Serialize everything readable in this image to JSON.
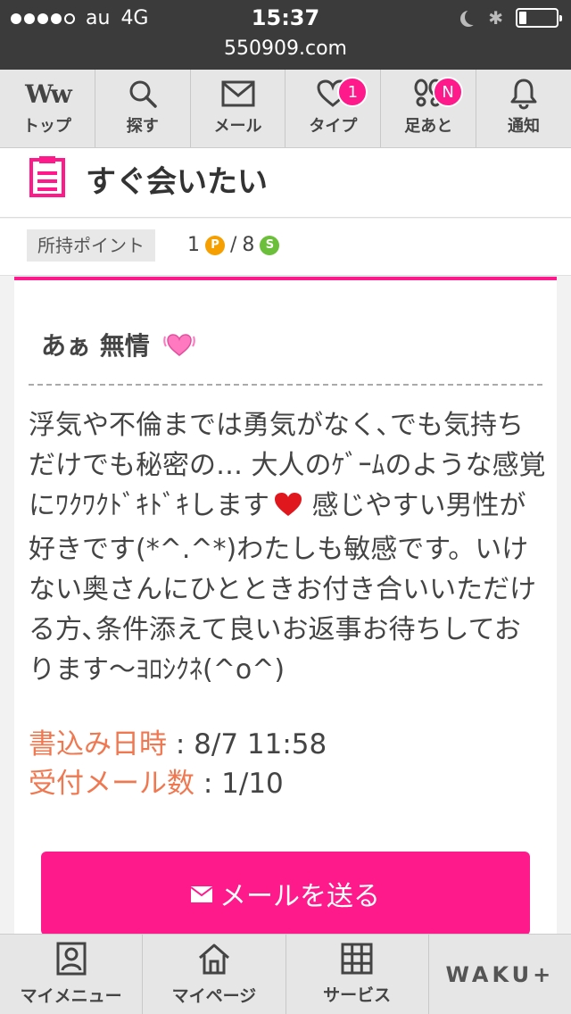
{
  "status": {
    "carrier": "au",
    "network": "4G",
    "time": "15:37",
    "url": "550909.com",
    "battery_level": 0.2
  },
  "nav": [
    {
      "label": "トップ",
      "icon": "ww-logo-icon"
    },
    {
      "label": "探す",
      "icon": "search-icon"
    },
    {
      "label": "メール",
      "icon": "mail-icon"
    },
    {
      "label": "タイプ",
      "icon": "heart-icon",
      "badge": "1"
    },
    {
      "label": "足あと",
      "icon": "footprint-icon",
      "badge": "N"
    },
    {
      "label": "通知",
      "icon": "bell-icon"
    }
  ],
  "nav_logo": "Ww",
  "page": {
    "title": "すぐ会いたい"
  },
  "points": {
    "label": "所持ポイント",
    "p_value": "1",
    "p_icon": "P",
    "separator": "/",
    "s_value": "8",
    "s_icon": "S"
  },
  "post": {
    "name": "あぁ 無情",
    "message_1": "浮気や不倫までは勇気がなく､でも気持ちだけでも秘密の… 大人のｹﾞｰﾑのような感覚にﾜｸﾜｸﾄﾞｷﾄﾞｷします",
    "message_2": " 感じやすい男性が好きです(*^.^*)わたしも敏感です。いけない奥さんにひとときお付き合いいただける方､条件添えて良いお返事お待ちしております〜ﾖﾛｼｸﾈ(^o^)",
    "posted_label": "書込み日時",
    "posted_value": ": 8/7 11:58",
    "received_label": "受付メール数",
    "received_value": ": 1/10",
    "send_label": "メールを送る"
  },
  "bottom_nav": [
    {
      "label": "マイメニュー",
      "icon": "profile-icon"
    },
    {
      "label": "マイページ",
      "icon": "home-icon"
    },
    {
      "label": "サービス",
      "icon": "grid-icon"
    },
    {
      "label": "WAKU+",
      "icon": "brand-logo"
    }
  ],
  "colors": {
    "accent": "#ff1a8c",
    "meta_key": "#f07850",
    "coin_p": "#f5a000",
    "coin_s": "#6cbf3a"
  }
}
